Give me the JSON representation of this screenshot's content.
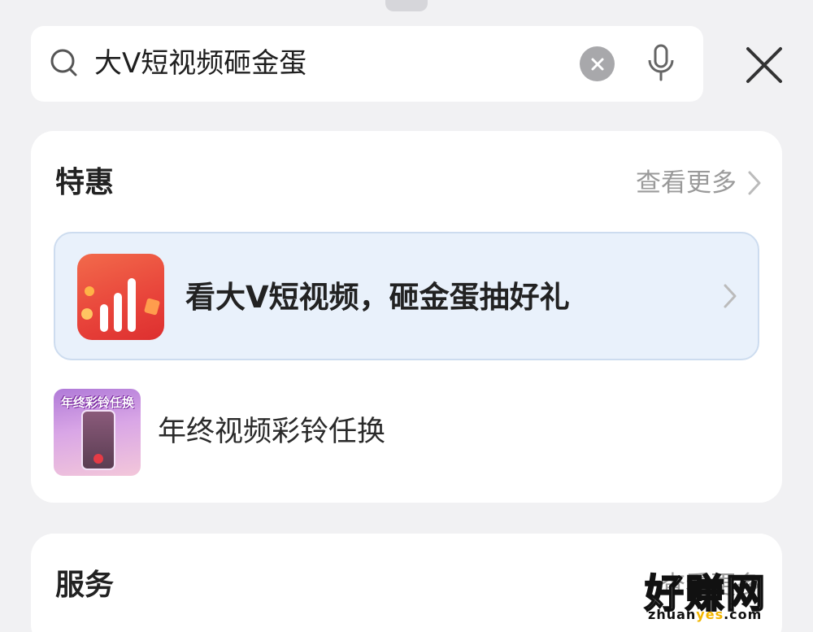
{
  "search": {
    "query": "大V短视频砸金蛋"
  },
  "deals": {
    "title": "特惠",
    "more_label": "查看更多",
    "promo": {
      "label": "看大V短视频，砸金蛋抽好礼",
      "icon": "bar-chart-app-icon"
    },
    "item": {
      "label": "年终视频彩铃任换",
      "thumb_title": "年终彩铃任换"
    }
  },
  "services": {
    "title": "服务",
    "more_label": "查看更多"
  },
  "watermark": {
    "big": "好赚网",
    "small_prefix": "zhuan",
    "small_accent": "yes",
    "small_suffix": ".com"
  },
  "colors": {
    "accent_red": "#e8433a",
    "promo_bg": "#e9f1fb",
    "muted": "#9a9a9a"
  }
}
